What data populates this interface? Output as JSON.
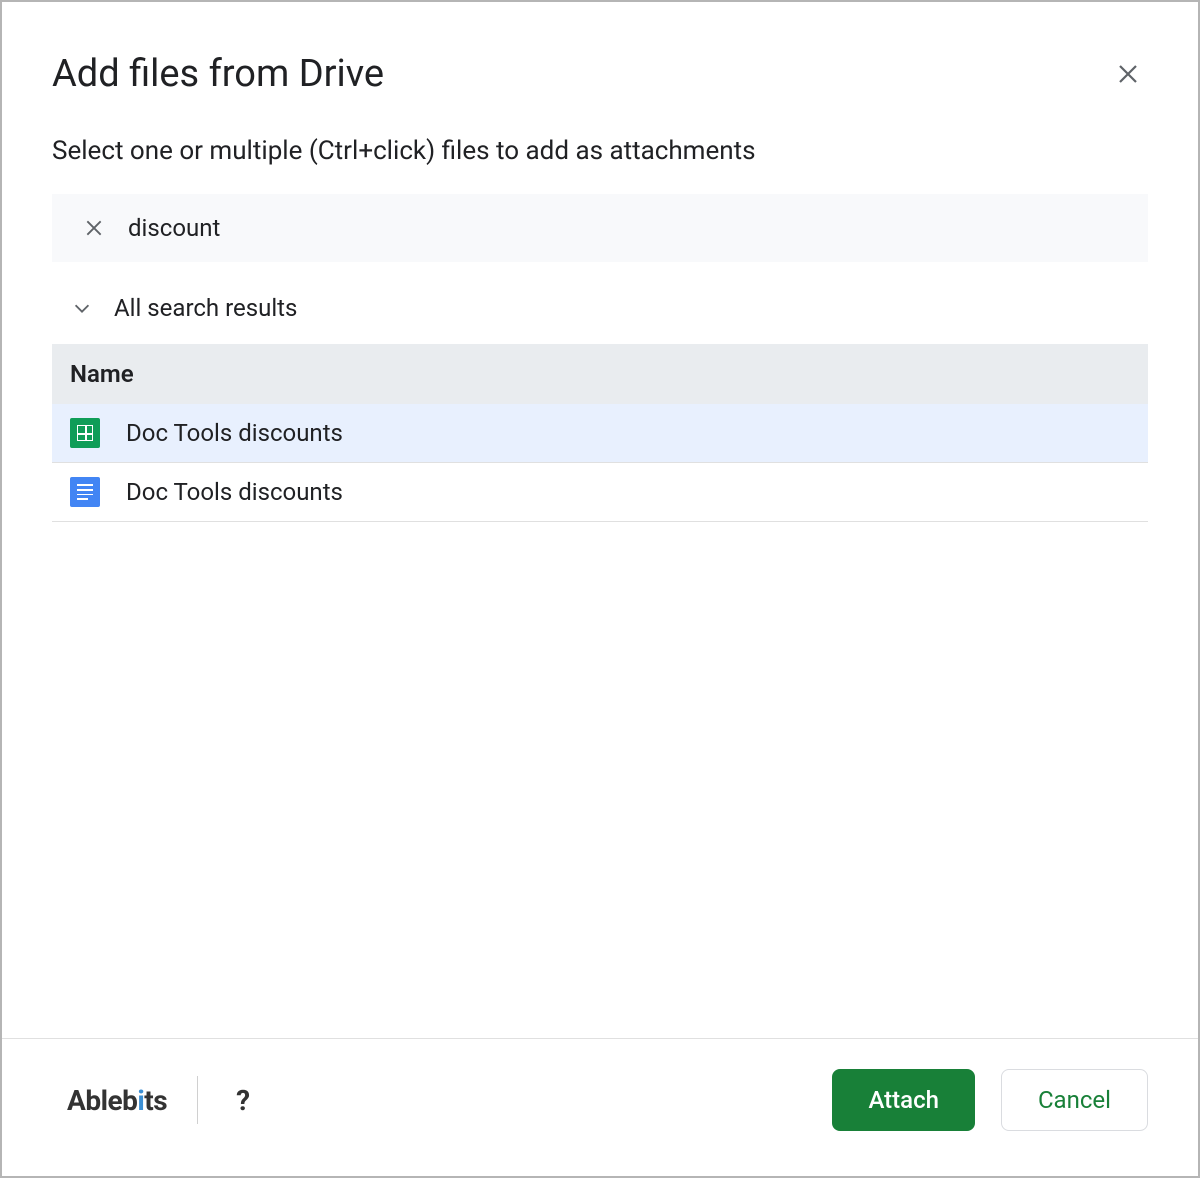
{
  "dialog": {
    "title": "Add files from Drive",
    "subtitle": "Select one or multiple (Ctrl+click) files to add as attachments"
  },
  "search": {
    "value": "discount"
  },
  "results": {
    "section_label": "All search results",
    "column_header": "Name",
    "files": [
      {
        "name": "Doc Tools discounts",
        "type": "sheets",
        "selected": true
      },
      {
        "name": "Doc Tools discounts",
        "type": "docs",
        "selected": false
      }
    ]
  },
  "footer": {
    "brand": "Ablebits",
    "help_label": "?",
    "attach_label": "Attach",
    "cancel_label": "Cancel"
  }
}
